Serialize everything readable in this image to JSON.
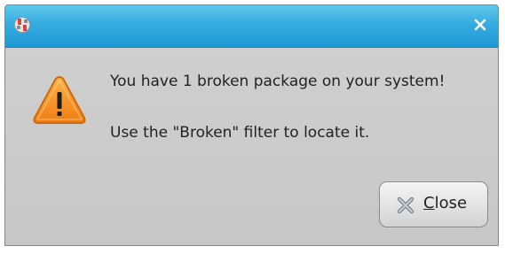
{
  "window": {
    "title": "",
    "app_icon": "package-manager-icon",
    "close_icon": "close-icon"
  },
  "message": {
    "line1": "You have 1 broken package on your system!",
    "line2": "Use the \"Broken\" filter to locate it.",
    "icon": "warning-icon"
  },
  "buttons": {
    "close_label_mnemonic": "C",
    "close_label_rest": "lose",
    "close_icon": "close-x-icon"
  },
  "colors": {
    "titlebar": "#2fa6dc",
    "body": "#c9c9c9",
    "warning_fill": "#f7941d"
  }
}
